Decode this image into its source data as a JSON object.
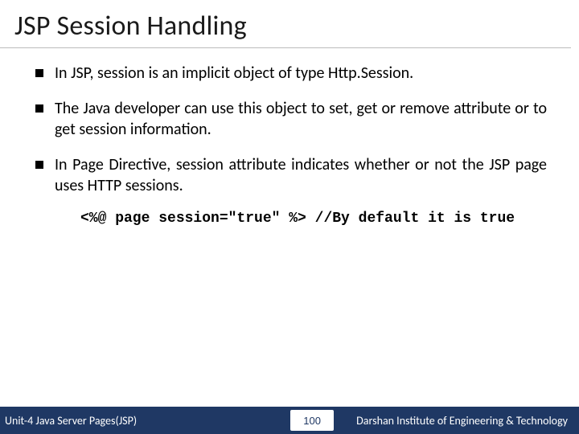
{
  "title": "JSP Session Handling",
  "bullets": [
    "In JSP, session is an implicit object of type Http.Session.",
    "The Java developer can use this object to set, get or remove attribute or to get session information.",
    "In Page Directive, session attribute indicates whether or not the JSP page uses HTTP sessions."
  ],
  "code_line": "<%@ page session=\"true\" %> //By default it is true",
  "footer": {
    "unit": "Unit-4 Java Server Pages(JSP)",
    "page": "100",
    "institute": "Darshan Institute of Engineering & Technology"
  }
}
